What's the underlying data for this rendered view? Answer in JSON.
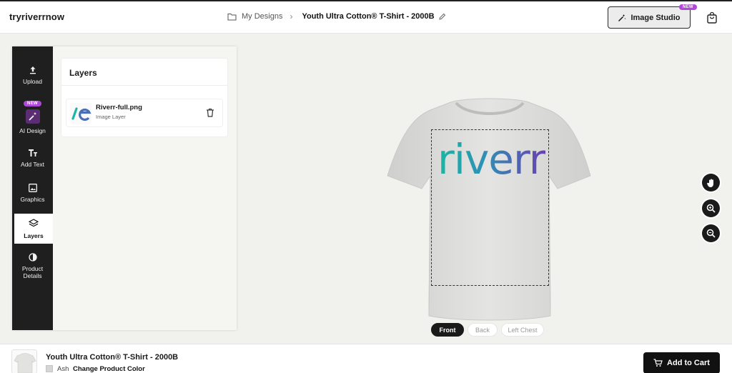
{
  "header": {
    "brand": "tryriverrnow",
    "breadcrumb": {
      "parent": "My Designs",
      "current": "Youth Ultra Cotton® T-Shirt - 2000B"
    },
    "studio_button": "Image Studio",
    "studio_badge": "NEW"
  },
  "sidebar": {
    "items": [
      {
        "label": "Upload",
        "icon": "upload-icon"
      },
      {
        "label": "AI Design",
        "icon": "magic-wand-icon",
        "badge": "NEW"
      },
      {
        "label": "Add Text",
        "icon": "text-icon"
      },
      {
        "label": "Graphics",
        "icon": "image-icon"
      },
      {
        "label": "Layers",
        "icon": "layers-icon",
        "active": true
      },
      {
        "label": "Product",
        "label2": "Details",
        "icon": "contrast-icon"
      }
    ]
  },
  "layers_panel": {
    "title": "Layers",
    "layers": [
      {
        "name": "Riverr-full.png",
        "type": "Image Layer"
      }
    ]
  },
  "canvas": {
    "logo_text": "riverr",
    "colors": {
      "logo_start": "#19b7a4",
      "logo_end": "#6a3fb5",
      "shirt": "#dcdcda"
    }
  },
  "view_tabs": [
    {
      "label": "Front",
      "active": true
    },
    {
      "label": "Back",
      "active": false
    },
    {
      "label": "Left Chest",
      "active": false
    }
  ],
  "bottom_bar": {
    "product_title": "Youth Ultra Cotton® T-Shirt - 2000B",
    "color_name": "Ash",
    "change_color_label": "Change Product Color",
    "add_to_cart_label": "Add to Cart"
  }
}
